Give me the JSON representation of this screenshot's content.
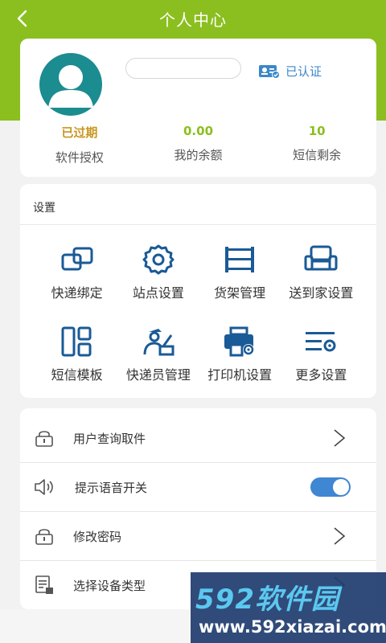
{
  "header": {
    "title": "个人中心"
  },
  "profile": {
    "verify_label": "已认证",
    "stats": [
      {
        "value": "已过期",
        "label": "软件授权"
      },
      {
        "value": "0.00",
        "label": "我的余额"
      },
      {
        "value": "10",
        "label": "短信剩余"
      }
    ]
  },
  "settings": {
    "title": "设置",
    "items": [
      {
        "label": "快递绑定",
        "icon": "link-icon"
      },
      {
        "label": "站点设置",
        "icon": "gear-icon"
      },
      {
        "label": "货架管理",
        "icon": "shelf-icon"
      },
      {
        "label": "送到家设置",
        "icon": "sofa-icon"
      },
      {
        "label": "短信模板",
        "icon": "template-icon"
      },
      {
        "label": "快递员管理",
        "icon": "courier-icon"
      },
      {
        "label": "打印机设置",
        "icon": "printer-icon"
      },
      {
        "label": "更多设置",
        "icon": "more-settings-icon"
      }
    ]
  },
  "list": [
    {
      "label": "用户查询取件",
      "icon": "lock-icon"
    },
    {
      "label": "提示语音开关",
      "icon": "speaker-icon",
      "toggle_on": true
    },
    {
      "label": "修改密码",
      "icon": "lock-icon"
    },
    {
      "label": "选择设备类型",
      "icon": "document-icon"
    }
  ],
  "watermark": {
    "brand": "592软件园",
    "url": "www.592xiazai.com"
  },
  "colors": {
    "brand_green": "#8bbf1f",
    "accent_blue": "#3f86d3",
    "icon_blue": "#1a5a96",
    "warning_gold": "#c9961e"
  }
}
